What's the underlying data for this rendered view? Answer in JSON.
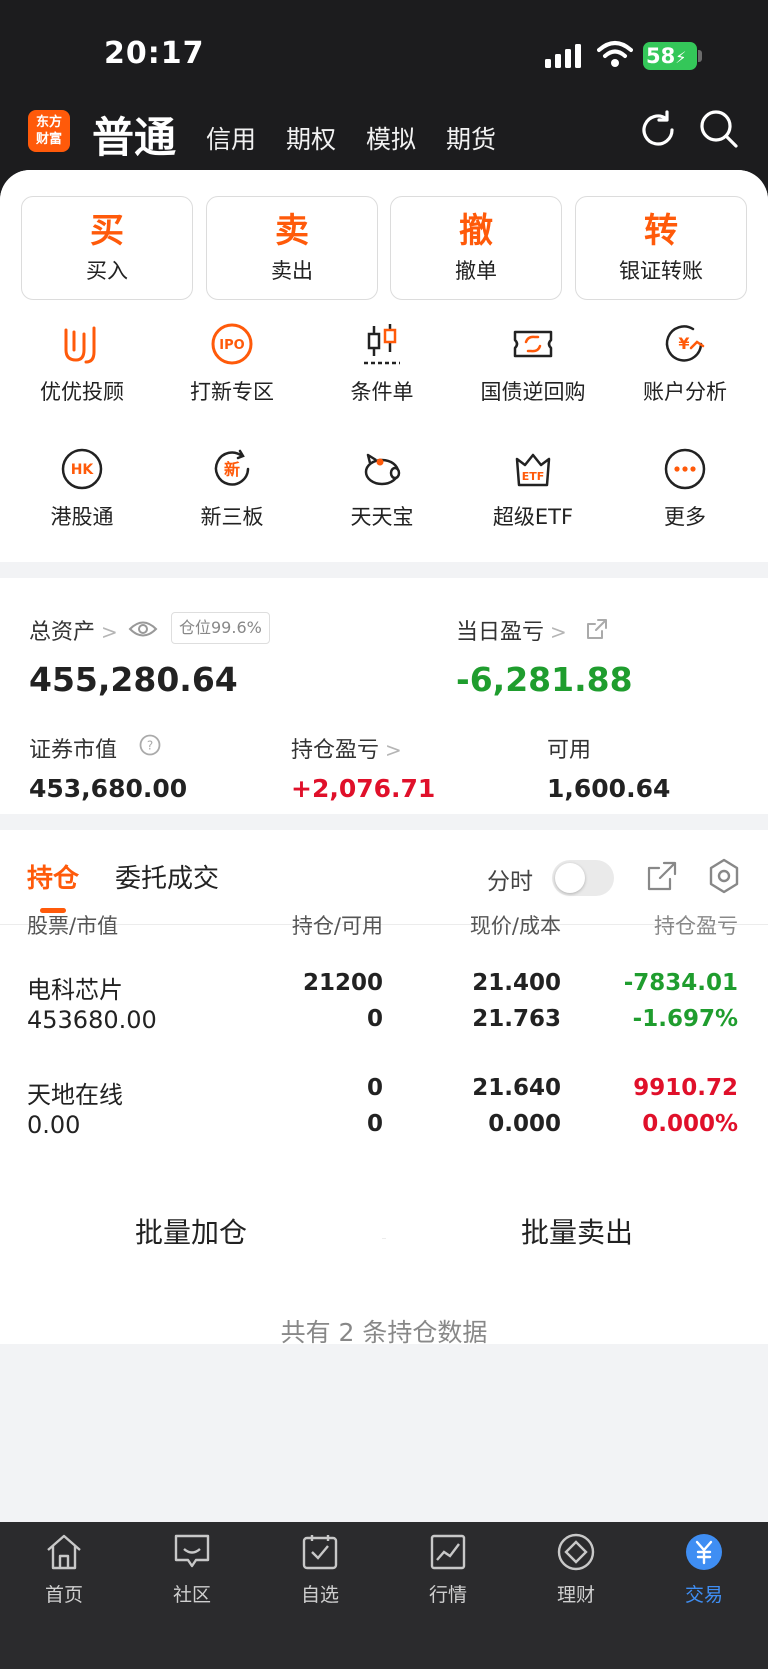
{
  "status_bar": {
    "time": "20:17",
    "battery": "58"
  },
  "top_nav": {
    "logo_line1": "东方",
    "logo_line2": "财富",
    "active_tab": "普通",
    "tabs": [
      "信用",
      "期权",
      "模拟",
      "期货"
    ]
  },
  "quick_actions": [
    {
      "char": "买",
      "label": "买入"
    },
    {
      "char": "卖",
      "label": "卖出"
    },
    {
      "char": "撤",
      "label": "撤单"
    },
    {
      "char": "转",
      "label": "银证转账"
    }
  ],
  "features": [
    {
      "label": "优优投顾",
      "icon": "advisor-icon"
    },
    {
      "label": "打新专区",
      "icon": "ipo-icon",
      "icon_text": "IPO"
    },
    {
      "label": "条件单",
      "icon": "candlestick-icon"
    },
    {
      "label": "国债逆回购",
      "icon": "bond-repo-icon"
    },
    {
      "label": "账户分析",
      "icon": "account-analysis-icon",
      "icon_text": "¥"
    },
    {
      "label": "港股通",
      "icon": "hk-connect-icon",
      "icon_text": "HK"
    },
    {
      "label": "新三板",
      "icon": "new-third-board-icon",
      "icon_text": "新"
    },
    {
      "label": "天天宝",
      "icon": "piggy-bank-icon"
    },
    {
      "label": "超级ETF",
      "icon": "etf-icon",
      "icon_text": "ETF"
    },
    {
      "label": "更多",
      "icon": "more-icon"
    }
  ],
  "assets": {
    "total_label": "总资产",
    "position_ratio": "仓位99.6%",
    "total_value": "455,280.64",
    "daily_pnl_label": "当日盈亏",
    "daily_pnl_value": "-6,281.88",
    "market_value_label": "证券市值",
    "market_value": "453,680.00",
    "holding_pnl_label": "持仓盈亏",
    "holding_pnl_value": "+2,076.71",
    "available_label": "可用",
    "available_value": "1,600.64"
  },
  "holdings_tabs": {
    "active": "持仓",
    "inactive": "委托成交",
    "toggle_label": "分时"
  },
  "table": {
    "headers": [
      "股票/市值",
      "持仓/可用",
      "现价/成本",
      "持仓盈亏"
    ],
    "rows": [
      {
        "name": "电科芯片",
        "market_value": "453680.00",
        "position": "21200",
        "available": "0",
        "price": "21.400",
        "cost": "21.763",
        "pnl": "-7834.01",
        "pnl_pct": "-1.697%"
      },
      {
        "name": "天地在线",
        "market_value": "0.00",
        "position": "0",
        "available": "0",
        "price": "21.640",
        "cost": "0.000",
        "pnl": "9910.72",
        "pnl_pct": "0.000%"
      }
    ]
  },
  "batch": {
    "add": "批量加仓",
    "sell": "批量卖出"
  },
  "footer_note": "共有 2 条持仓数据",
  "bottom_nav": [
    {
      "label": "首页",
      "icon": "home-icon"
    },
    {
      "label": "社区",
      "icon": "community-icon"
    },
    {
      "label": "自选",
      "icon": "watchlist-icon"
    },
    {
      "label": "行情",
      "icon": "market-icon"
    },
    {
      "label": "理财",
      "icon": "wealth-icon"
    },
    {
      "label": "交易",
      "icon": "trade-icon",
      "active": true
    }
  ],
  "colors": {
    "accent": "#ff5a0a",
    "loss": "#1f9d2e",
    "gain": "#e0102a",
    "active_nav": "#3f8ef3"
  }
}
